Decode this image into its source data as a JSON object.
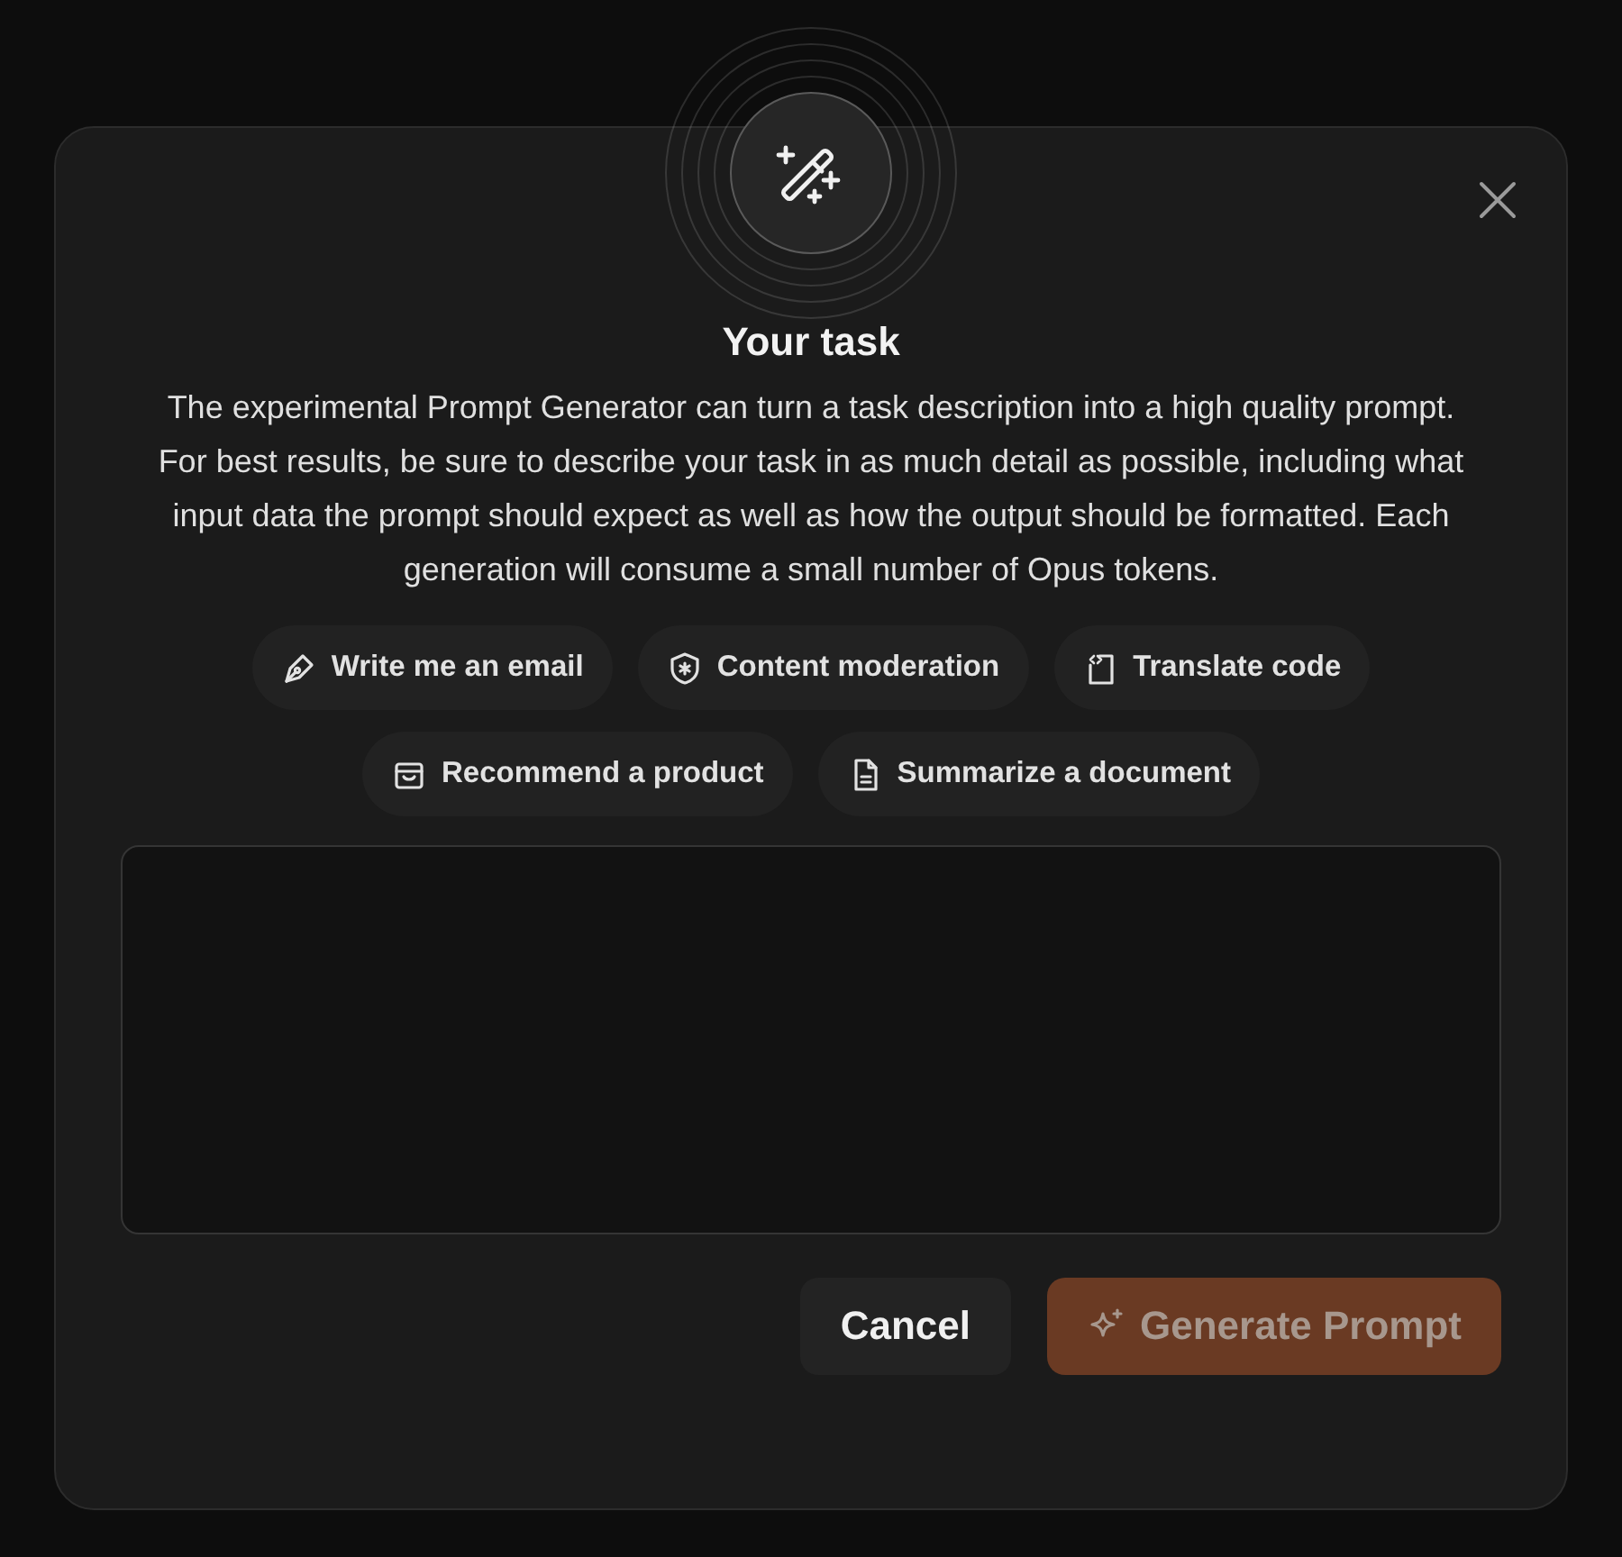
{
  "dialog": {
    "title": "Your task",
    "description": "The experimental Prompt Generator can turn a task description into a high quality prompt. For best results, be sure to describe your task in as much detail as possible, including what input data the prompt should expect as well as how the output should be formatted. Each generation will consume a small number of Opus tokens.",
    "suggestions": [
      {
        "kind": "pen",
        "label": "Write me an email"
      },
      {
        "kind": "shield",
        "label": "Content moderation"
      },
      {
        "kind": "code",
        "label": "Translate code"
      },
      {
        "kind": "bag",
        "label": "Recommend a product"
      },
      {
        "kind": "document",
        "label": "Summarize a document"
      }
    ],
    "buttons": [
      {
        "kind": "secondary",
        "label": "Cancel",
        "disabled": false
      },
      {
        "kind": "primary",
        "label": "Generate Prompt",
        "disabled": true
      }
    ]
  }
}
